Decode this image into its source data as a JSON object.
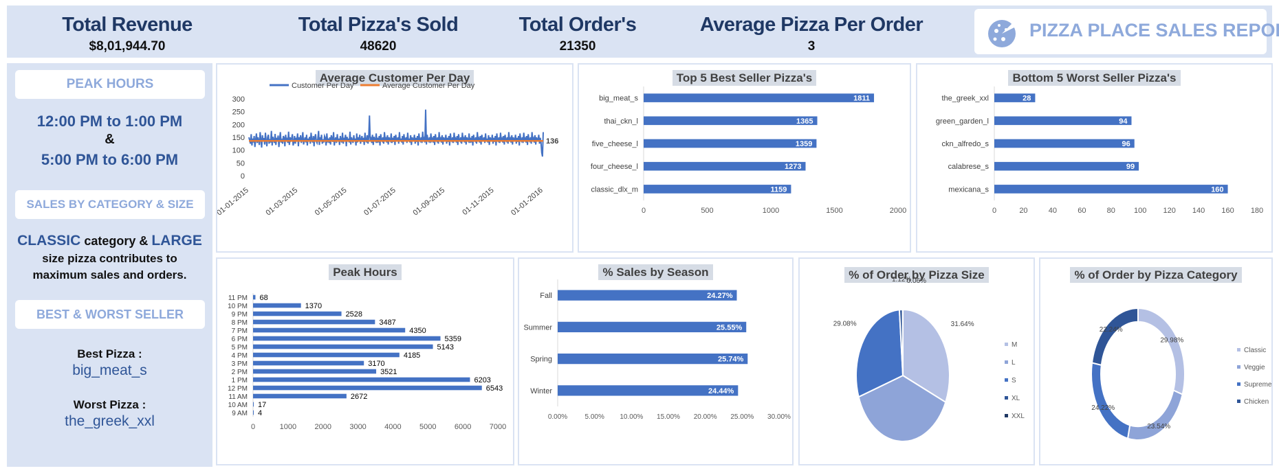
{
  "kpis": {
    "revenue": {
      "label": "Total Revenue",
      "value": "$8,01,944.70"
    },
    "pizzas": {
      "label": "Total Pizza's Sold",
      "value": "48620"
    },
    "orders": {
      "label": "Total Order's",
      "value": "21350"
    },
    "avg": {
      "label": "Average Pizza Per Order",
      "value": "3"
    }
  },
  "report_title": "PIZZA PLACE SALES REPORT",
  "sidebar": {
    "peak_hours_heading": "PEAK HOURS",
    "peak_line1": "12:00 PM to 1:00 PM",
    "peak_amp": "&",
    "peak_line2": "5:00 PM to 6:00 PM",
    "sales_heading": "SALES BY CATEGORY & SIZE",
    "sales_word1": "CLASSIC",
    "sales_mid": " category & ",
    "sales_word2": "LARGE",
    "sales_line2": "size pizza contributes to",
    "sales_line3": "maximum sales and orders.",
    "best_worst_heading": "BEST & WORST SELLER",
    "best_label": "Best Pizza :",
    "best_value": "big_meat_s",
    "worst_label": "Worst Pizza :",
    "worst_value": "the_greek_xxl"
  },
  "colors": {
    "primary": "#4472c4",
    "dark_text": "#1f3864",
    "panel_bg": "#dae3f3",
    "accent_light": "#8ea9db",
    "orange": "#ed7d31"
  },
  "chart_data": [
    {
      "id": "avg_customers",
      "type": "line",
      "title": "Average Customer Per Day",
      "legend": [
        "Customer Per Day",
        "Average Customer Per Day"
      ],
      "ylim": [
        0,
        300
      ],
      "yticks": [
        0,
        50,
        100,
        150,
        200,
        250,
        300
      ],
      "xticks": [
        "01-01-2015",
        "01-03-2015",
        "01-05-2015",
        "01-07-2015",
        "01-09-2015",
        "01-11-2015",
        "01-01-2016"
      ],
      "x_start": "01-01-2015",
      "x_end": "01-01-2016",
      "series": [
        {
          "name": "Customer Per Day",
          "values": [
            150,
            138,
            125,
            162,
            118,
            145,
            130,
            155,
            112,
            140,
            165,
            128,
            150,
            135,
            120,
            170,
            142,
            110,
            158,
            133,
            147,
            122,
            168,
            138,
            115,
            150,
            160,
            125,
            143,
            130,
            175,
            118,
            152,
            140,
            128,
            163,
            120,
            148,
            135,
            157,
            112,
            145,
            170,
            130,
            138,
            125,
            155,
            148,
            115,
            160,
            135,
            142,
            128,
            172,
            120,
            150,
            138,
            145,
            162,
            118,
            130,
            155,
            125,
            148,
            140,
            165,
            115,
            150,
            135,
            158,
            128,
            143,
            170,
            122,
            138,
            150,
            130,
            160,
            118,
            145,
            135,
            152,
            125,
            168,
            140,
            130,
            155,
            115,
            148,
            162,
            135,
            128,
            145,
            175,
            120,
            150,
            138,
            160,
            125,
            142,
            130,
            155,
            148,
            118,
            165,
            135,
            140,
            128,
            150,
            122,
            158,
            145,
            132,
            170,
            118,
            140,
            150,
            128,
            162,
            135,
            145,
            120,
            155,
            138,
            130,
            168,
            125,
            148,
            140,
            160,
            115,
            152,
            135,
            145,
            130,
            172,
            122,
            150,
            140,
            128,
            158,
            135,
            145,
            118,
            165,
            130,
            150,
            138,
            160,
            125,
            142,
            155,
            132,
            148,
            120,
            168,
            140,
            130,
            158,
            125,
            150,
            235,
            138,
            145,
            128,
            160,
            120,
            152,
            140,
            135,
            165,
            128,
            148,
            130,
            155,
            118,
            162,
            140,
            135,
            150,
            125,
            170,
            138,
            145,
            130,
            158,
            122,
            150,
            140,
            135,
            165,
            128,
            148,
            132,
            155,
            120,
            160,
            140,
            138,
            150,
            125,
            170,
            135,
            145,
            130,
            155,
            122,
            162,
            138,
            140,
            150,
            128,
            168,
            135,
            145,
            130,
            158,
            120,
            150,
            140,
            138,
            160,
            125,
            148,
            132,
            155,
            118,
            165,
            140,
            135,
            150,
            128,
            172,
            138,
            145,
            130,
            258,
            122,
            160,
            140,
            135,
            150,
            128,
            165,
            138,
            145,
            130,
            155,
            120,
            162,
            140,
            135,
            150,
            125,
            170,
            138,
            145,
            130,
            158,
            122,
            150,
            140,
            138,
            160,
            125,
            148,
            132,
            155,
            118,
            165,
            140,
            135,
            150,
            128,
            168,
            138,
            145,
            130,
            155,
            120,
            162,
            140,
            135,
            150,
            125,
            168,
            138,
            145,
            130,
            158,
            122,
            150,
            140,
            135,
            165,
            128,
            148,
            130,
            155,
            118,
            160,
            140,
            135,
            150,
            125,
            170,
            138,
            145,
            130,
            155,
            122,
            160,
            140,
            138,
            150,
            128,
            165,
            135,
            145,
            130,
            158,
            120,
            150,
            140,
            138,
            160,
            125,
            148,
            132,
            155,
            118,
            165,
            140,
            135,
            150,
            128,
            168,
            138,
            145,
            130,
            155,
            122,
            160,
            140,
            135,
            150,
            125,
            170,
            138,
            145,
            130,
            158,
            122,
            150,
            140,
            138,
            160,
            125,
            148,
            132,
            155,
            118,
            165,
            140,
            135,
            150,
            128,
            168,
            138,
            145,
            130,
            155,
            120,
            162,
            140,
            135,
            150,
            125,
            170,
            138,
            145,
            130,
            158,
            122,
            150,
            140,
            138,
            160,
            125,
            148,
            132,
            90,
            75,
            170
          ]
        },
        {
          "name": "Average Customer Per Day",
          "value": 136
        }
      ],
      "avg_label": "136"
    },
    {
      "id": "top5",
      "type": "bar",
      "title": "Top 5 Best Seller Pizza's",
      "categories": [
        "big_meat_s",
        "thai_ckn_l",
        "five_cheese_l",
        "four_cheese_l",
        "classic_dlx_m"
      ],
      "values": [
        1811,
        1365,
        1359,
        1273,
        1159
      ],
      "xlim": [
        0,
        2000
      ],
      "xticks": [
        "0",
        "500",
        "1000",
        "1500",
        "2000"
      ]
    },
    {
      "id": "bottom5",
      "type": "bar",
      "title": "Bottom 5 Worst Seller Pizza's",
      "categories": [
        "the_greek_xxl",
        "green_garden_l",
        "ckn_alfredo_s",
        "calabrese_s",
        "mexicana_s"
      ],
      "values": [
        28,
        94,
        96,
        99,
        160
      ],
      "xlim": [
        0,
        180
      ],
      "xticks": [
        "0",
        "20",
        "40",
        "60",
        "80",
        "100",
        "120",
        "140",
        "160",
        "180"
      ]
    },
    {
      "id": "peak_hours",
      "type": "bar",
      "title": "Peak Hours",
      "categories": [
        "11 PM",
        "10 PM",
        "9 PM",
        "8 PM",
        "7 PM",
        "6 PM",
        "5 PM",
        "4 PM",
        "3 PM",
        "2 PM",
        "1 PM",
        "12 PM",
        "11 AM",
        "10 AM",
        "9 AM"
      ],
      "values": [
        68,
        1370,
        2528,
        3487,
        4350,
        5359,
        5143,
        4185,
        3170,
        3521,
        6203,
        6543,
        2672,
        17,
        4
      ],
      "xlim": [
        0,
        7000
      ],
      "xticks": [
        "0",
        "1000",
        "2000",
        "3000",
        "4000",
        "5000",
        "6000",
        "7000"
      ]
    },
    {
      "id": "season",
      "type": "bar",
      "title": "% Sales by Season",
      "categories": [
        "Fall",
        "Summer",
        "Spring",
        "Winter"
      ],
      "values": [
        24.27,
        25.55,
        25.74,
        24.44
      ],
      "labels": [
        "24.27%",
        "25.55%",
        "25.74%",
        "24.44%"
      ],
      "xlim": [
        0,
        30
      ],
      "xticks": [
        "0.00%",
        "5.00%",
        "10.00%",
        "15.00%",
        "20.00%",
        "25.00%",
        "30.00%"
      ]
    },
    {
      "id": "size",
      "type": "pie",
      "title": "% of Order by Pizza Size",
      "categories": [
        "M",
        "L",
        "S",
        "XL",
        "XXL"
      ],
      "values": [
        31.64,
        38.1,
        29.08,
        1.12,
        0.06
      ],
      "labels": [
        "31.64%",
        "38.10%",
        "29.08%",
        "1.12%",
        "0.06%"
      ],
      "colors": [
        "#b4c0e4",
        "#8ea4d8",
        "#4472c4",
        "#2f5597",
        "#1f3864"
      ]
    },
    {
      "id": "category",
      "type": "pie",
      "title": "% of Order by Pizza Category",
      "categories": [
        "Classic",
        "Veggie",
        "Supreme",
        "Chicken"
      ],
      "values": [
        29.98,
        23.54,
        24.22,
        22.24
      ],
      "labels": [
        "29.98%",
        "23.54%",
        "24.22%",
        "22.24%"
      ],
      "colors": [
        "#b4c0e4",
        "#8ea4d8",
        "#4472c4",
        "#2f5597"
      ]
    }
  ]
}
